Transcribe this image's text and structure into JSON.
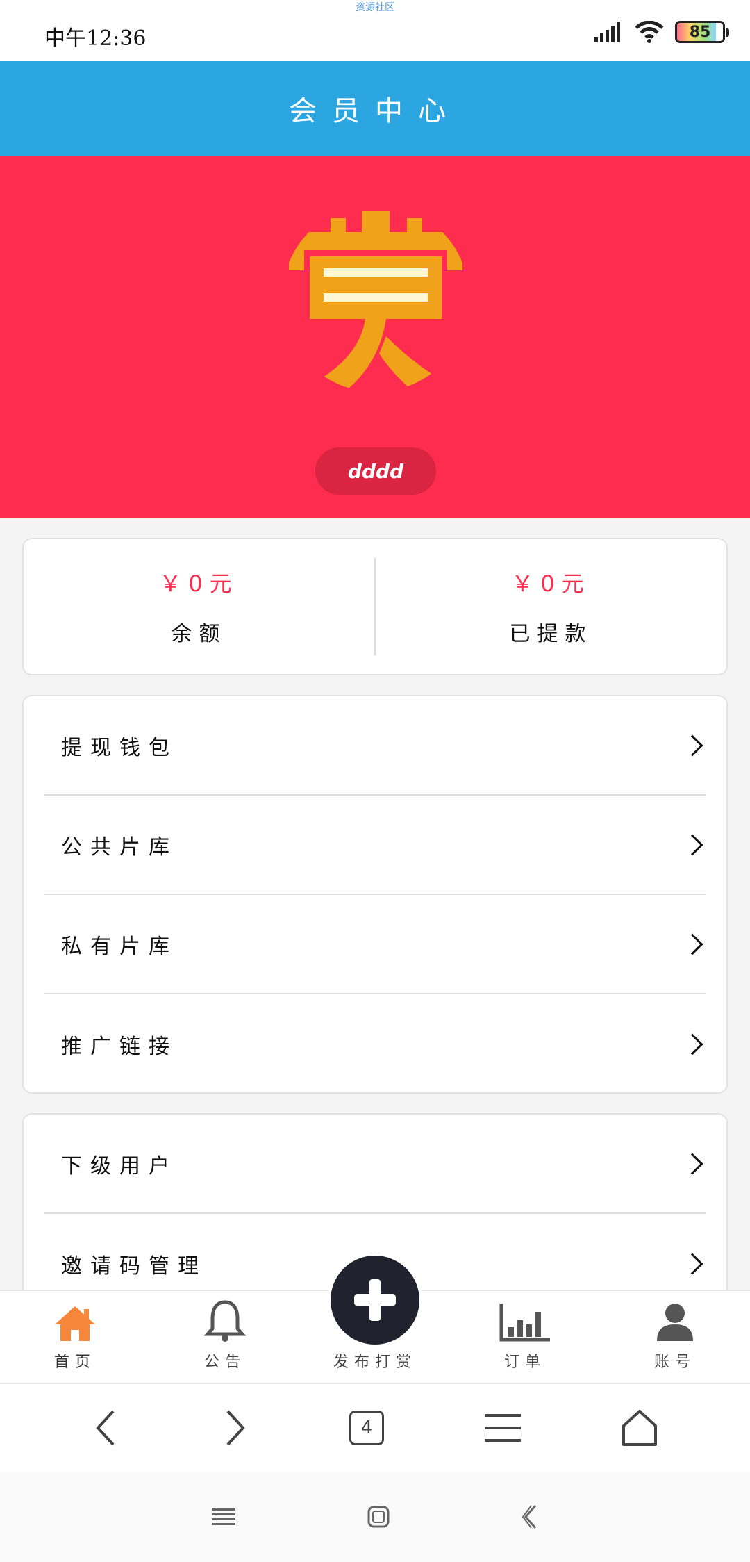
{
  "status_bar": {
    "time": "中午12:36",
    "watermark": "资源社区",
    "battery": "85",
    "icons": [
      "signal-icon",
      "wifi-icon",
      "battery-icon"
    ]
  },
  "header": {
    "title": "会员中心"
  },
  "hero": {
    "avatar_text": "赏",
    "username": "dddd",
    "colors": {
      "header": "#2ba6e1",
      "hero": "#fe2c4e",
      "pill": "#d92442",
      "avatar": "#f0a21a"
    }
  },
  "balance": {
    "items": [
      {
        "amount": "￥0元",
        "label": "余额"
      },
      {
        "amount": "￥0元",
        "label": "已提款"
      }
    ]
  },
  "menu": {
    "group1": [
      {
        "label": "提现钱包"
      },
      {
        "label": "公共片库"
      },
      {
        "label": "私有片库"
      },
      {
        "label": "推广链接"
      }
    ],
    "group2": [
      {
        "label": "下级用户"
      },
      {
        "label": "邀请码管理"
      }
    ]
  },
  "tabbar": {
    "items": [
      {
        "label": "首页",
        "icon": "home-icon",
        "active": true
      },
      {
        "label": "公告",
        "icon": "bell-icon"
      },
      {
        "label": "发布打赏",
        "icon": "plus-icon"
      },
      {
        "label": "订单",
        "icon": "bar-chart-icon"
      },
      {
        "label": "账号",
        "icon": "user-icon"
      }
    ],
    "active_color": "#f5863a"
  },
  "browser_bar": {
    "tab_count": "4",
    "icons": [
      "back-icon",
      "forward-icon",
      "tabs-icon",
      "menu-icon",
      "home-outline-icon"
    ]
  },
  "system_nav": {
    "icons": [
      "recent-apps-icon",
      "home-square-icon",
      "back-nav-icon"
    ]
  }
}
